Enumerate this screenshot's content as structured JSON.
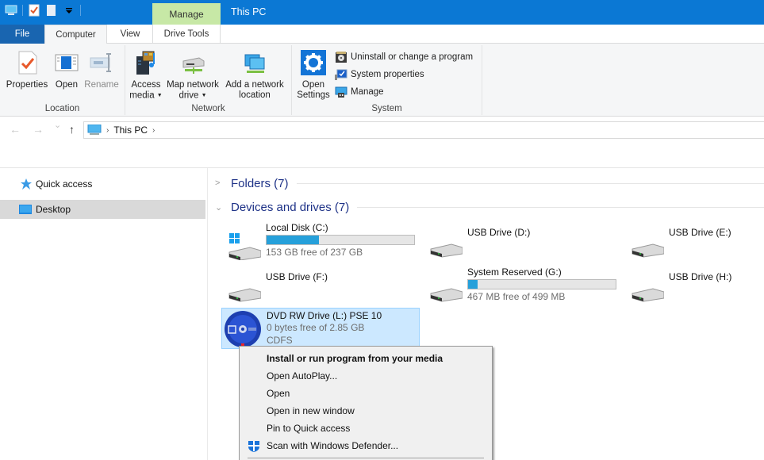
{
  "window": {
    "title": "This PC",
    "contextual_tab_group": "Manage",
    "accent_color": "#0b78d4",
    "contextual_color": "#c7e8a6"
  },
  "quick_access_toolbar": {
    "icons": [
      "computer-icon",
      "properties-icon",
      "new-folder-icon",
      "customize-dropdown-icon"
    ]
  },
  "ribbon_tabs": [
    {
      "label": "File",
      "active": false
    },
    {
      "label": "Computer",
      "active": true
    },
    {
      "label": "View",
      "active": false
    },
    {
      "label": "Drive Tools",
      "active": false
    }
  ],
  "ribbon": {
    "groups": {
      "location": {
        "label": "Location",
        "buttons": [
          {
            "label": "Properties",
            "icon": "properties-icon",
            "enabled": true
          },
          {
            "label": "Open",
            "icon": "open-icon",
            "enabled": true
          },
          {
            "label": "Rename",
            "icon": "rename-icon",
            "enabled": false
          }
        ]
      },
      "network": {
        "label": "Network",
        "buttons": [
          {
            "label_line1": "Access",
            "label_line2": "media",
            "icon": "access-media-icon",
            "dropdown": true
          },
          {
            "label_line1": "Map network",
            "label_line2": "drive",
            "icon": "map-network-drive-icon",
            "dropdown": true
          },
          {
            "label_line1": "Add a network",
            "label_line2": "location",
            "icon": "add-network-location-icon",
            "dropdown": false
          }
        ]
      },
      "system": {
        "label": "System",
        "open_settings": {
          "label_line1": "Open",
          "label_line2": "Settings"
        },
        "small_buttons": [
          {
            "label": "Uninstall or change a program",
            "icon": "uninstall-icon"
          },
          {
            "label": "System properties",
            "icon": "system-properties-icon"
          },
          {
            "label": "Manage",
            "icon": "manage-icon"
          }
        ]
      }
    }
  },
  "navigation": {
    "back_label": "←",
    "forward_label": "→",
    "recent_label": "⌄",
    "up_label": "↑",
    "breadcrumb": [
      "This PC"
    ],
    "separator": "›"
  },
  "sidebar": {
    "items": [
      {
        "label": "Quick access",
        "icon": "star-icon",
        "selected": false
      },
      {
        "label": "Desktop",
        "icon": "desktop-icon",
        "selected": true
      }
    ]
  },
  "sections": {
    "folders": {
      "title": "Folders (7)",
      "expanded": false
    },
    "devices": {
      "title": "Devices and drives (7)",
      "expanded": true
    }
  },
  "drives": [
    {
      "name": "Local Disk (C:)",
      "free_text": "153 GB free of 237 GB",
      "used_fraction": 0.354,
      "type": "local-disk",
      "selected": false
    },
    {
      "name": "USB Drive (D:)",
      "type": "usb",
      "selected": false
    },
    {
      "name": "USB Drive (E:)",
      "type": "usb",
      "selected": false
    },
    {
      "name": "USB Drive (F:)",
      "type": "usb",
      "selected": false
    },
    {
      "name": "System Reserved (G:)",
      "free_text": "467 MB free of 499 MB",
      "used_fraction": 0.064,
      "type": "hdd",
      "selected": false
    },
    {
      "name": "USB Drive (H:)",
      "type": "usb",
      "selected": false
    },
    {
      "name": "DVD RW Drive (L:) PSE 10",
      "free_text": "0 bytes free of 2.85 GB",
      "filesystem": "CDFS",
      "type": "dvd",
      "selected": true
    }
  ],
  "context_menu": {
    "items": [
      {
        "label": "Install or run program from your media",
        "bold": true
      },
      {
        "label": "Open AutoPlay..."
      },
      {
        "label": "Open"
      },
      {
        "label": "Open in new window"
      },
      {
        "label": "Pin to Quick access"
      },
      {
        "label": "Scan with Windows Defender...",
        "icon": "windows-defender-icon"
      }
    ]
  }
}
